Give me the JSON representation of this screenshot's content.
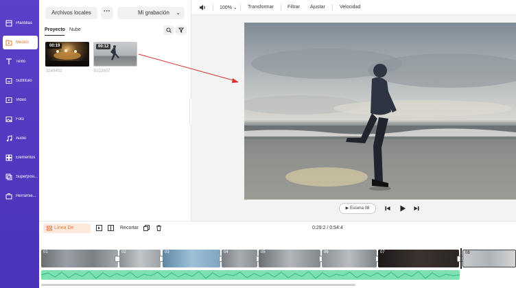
{
  "sidebar": {
    "items": [
      {
        "label": "Plantillas",
        "icon": "templates-icon",
        "active": false
      },
      {
        "label": "Medios",
        "icon": "media-folder-icon",
        "active": true
      },
      {
        "label": "Texto",
        "icon": "text-icon",
        "active": false
      },
      {
        "label": "Subtítulo",
        "icon": "subtitle-icon",
        "active": false
      },
      {
        "label": "Video",
        "icon": "video-icon",
        "active": false
      },
      {
        "label": "Foto",
        "icon": "photo-icon",
        "active": false
      },
      {
        "label": "Audio",
        "icon": "music-icon",
        "active": false
      },
      {
        "label": "Elementos",
        "icon": "elements-icon",
        "active": false
      },
      {
        "label": "Superposi...",
        "icon": "overlay-icon",
        "active": false
      },
      {
        "label": "Herramie...",
        "icon": "tools-icon",
        "active": false
      }
    ]
  },
  "media": {
    "local_files_label": "Archivos locales",
    "more_label": "···",
    "recording_label": "Mi grabación",
    "tabs": [
      "Proyecto",
      "Nube"
    ],
    "items": [
      {
        "duration": "00:19",
        "name": "3249402"
      },
      {
        "duration": "00:12",
        "name": "5123907"
      }
    ]
  },
  "toolbar": {
    "zoom": "100%",
    "transform": "Transformar",
    "filter": "Filtrar",
    "adjust": "Ajustar",
    "speed": "Velocidad"
  },
  "player": {
    "scene_label": "Escena 08"
  },
  "timeline": {
    "mode_label": "Línea De Tiempo",
    "crop_label": "Recortar",
    "time": "0:29:2 / 0:54:4",
    "clips": [
      "01",
      "02",
      "03",
      "04",
      "05",
      "06",
      "07",
      "08"
    ]
  },
  "colors": {
    "sidebar": "#4a33b8",
    "accent": "#e07b39",
    "audio": "#7fe0b3",
    "arrow": "#d9302c"
  }
}
